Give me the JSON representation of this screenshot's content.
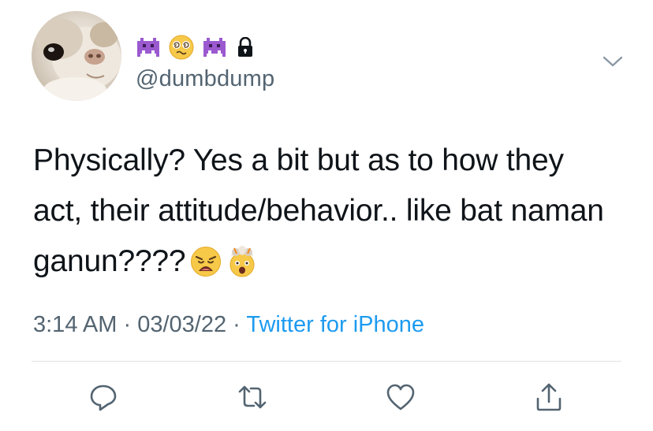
{
  "header": {
    "name_icons": [
      "alien-monster-icon",
      "dizzy-face-icon",
      "alien-monster-icon",
      "lock-icon"
    ],
    "handle": "@dumbdump"
  },
  "tweet": {
    "text": "Physically? Yes a bit but as to how they act, their attitude/behavior.. like bat naman ganun????",
    "emojis": [
      "weary-face-icon",
      "exploding-head-icon"
    ],
    "time": "3:14 AM",
    "date": "03/03/22",
    "separator": "·",
    "source": "Twitter for iPhone"
  },
  "actions": [
    "reply-icon",
    "retweet-icon",
    "like-icon",
    "share-icon"
  ],
  "colors": {
    "text": "#0f1419",
    "secondary": "#536471",
    "link": "#1d9bf0",
    "divider": "#dfe3e6",
    "monster": "#9b59d0"
  }
}
